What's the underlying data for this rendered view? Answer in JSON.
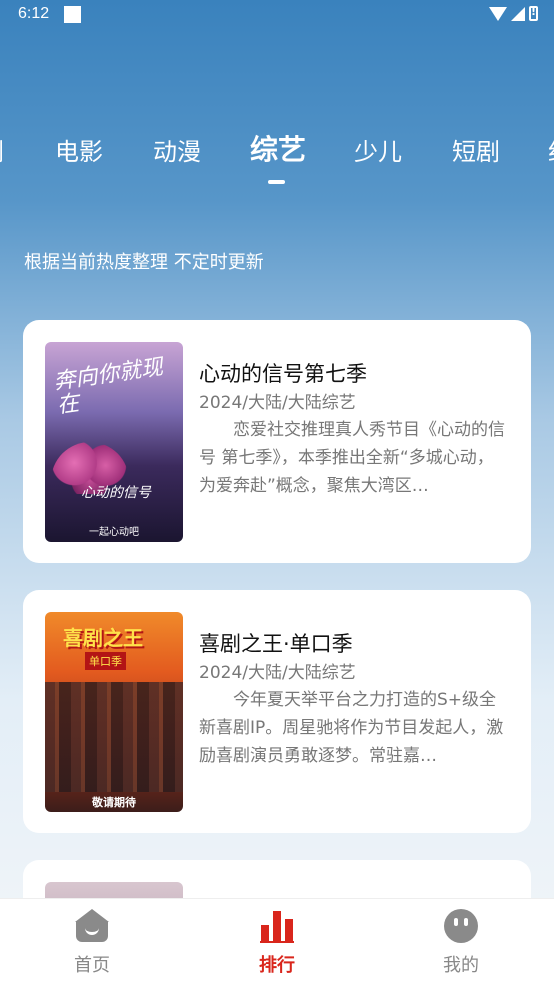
{
  "status_bar": {
    "time": "6:12"
  },
  "tabs": [
    {
      "label": "剧"
    },
    {
      "label": "电影"
    },
    {
      "label": "动漫"
    },
    {
      "label": "综艺",
      "active": true
    },
    {
      "label": "少儿"
    },
    {
      "label": "短剧"
    },
    {
      "label": "纪"
    }
  ],
  "subtitle": "根据当前热度整理 不定时更新",
  "cards": [
    {
      "title": "心动的信号第七季",
      "meta": "2024/大陆/大陆综艺",
      "description": "恋爱社交推理真人秀节目《心动的信号 第七季》，本季推出全新“多城心动，为爱奔赴”概念，聚焦大湾区…",
      "poster": {
        "headline": "奔向你就现在",
        "logo": "心动的信号",
        "footer": "一起心动吧"
      }
    },
    {
      "title": "喜剧之王·单口季",
      "meta": "2024/大陆/大陆综艺",
      "description": "今年夏天举平台之力打造的S+级全新喜剧IP。周星驰将作为节目发起人，激励喜剧演员勇敢逐梦。常驻嘉…",
      "poster": {
        "headline": "喜剧之王",
        "sub": "单口季",
        "footer": "敬请期待"
      }
    }
  ],
  "bottom_nav": [
    {
      "label": "首页",
      "icon": "home-icon"
    },
    {
      "label": "排行",
      "icon": "rank-icon",
      "active": true
    },
    {
      "label": "我的",
      "icon": "profile-icon"
    }
  ],
  "colors": {
    "accent": "#d9261c",
    "inactive": "#888888"
  }
}
